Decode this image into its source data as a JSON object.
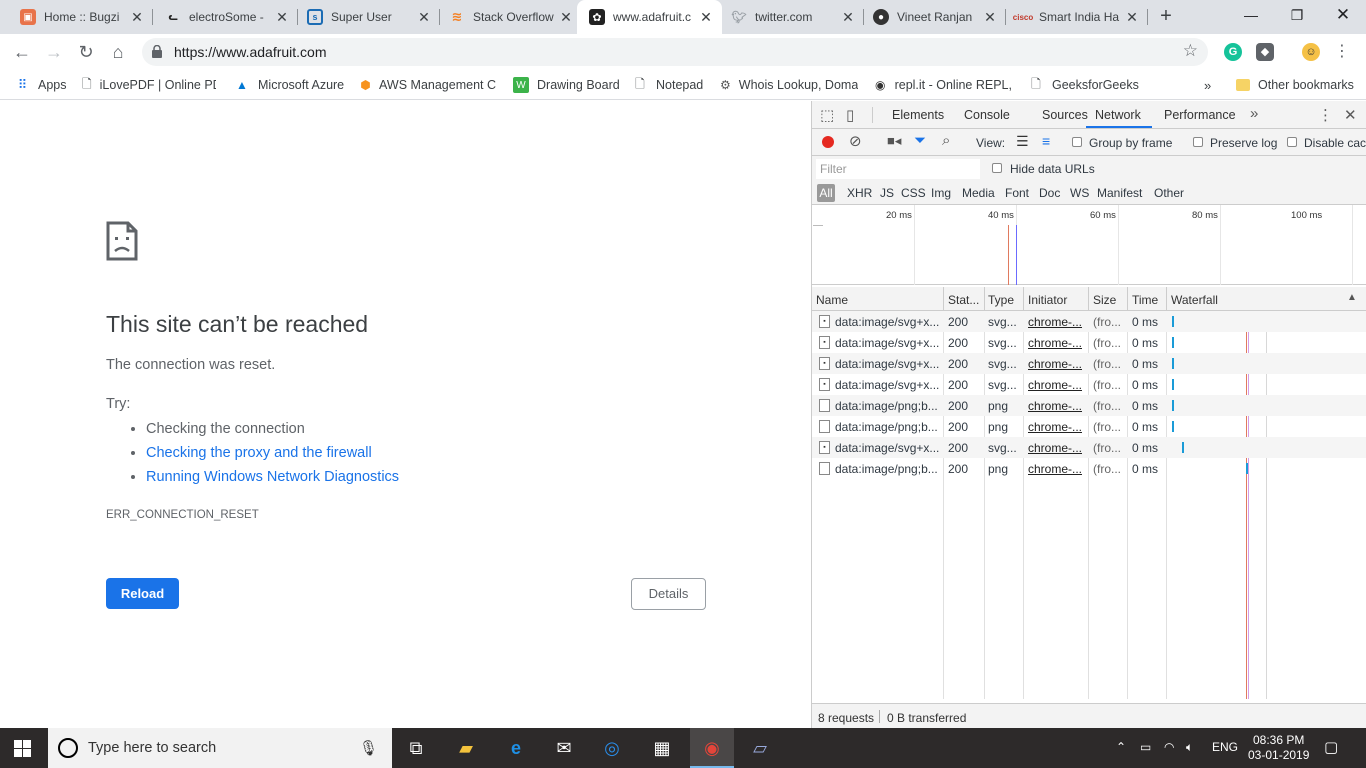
{
  "tabs": [
    {
      "title": "Home :: Bugzi",
      "icon": "bugzilla-icon"
    },
    {
      "title": "electroSome -",
      "icon": "electrosome-icon"
    },
    {
      "title": "Super User",
      "icon": "superuser-icon"
    },
    {
      "title": "Stack Overflow",
      "icon": "stackoverflow-icon"
    },
    {
      "title": "www.adafruit.c",
      "icon": "adafruit-icon",
      "active": true
    },
    {
      "title": "twitter.com",
      "icon": "twitter-icon"
    },
    {
      "title": "Vineet Ranjan",
      "icon": "github-icon"
    },
    {
      "title": "Smart India Ha",
      "icon": "cisco-icon"
    }
  ],
  "address": {
    "url": "https://www.adafruit.com"
  },
  "bookmarks": [
    {
      "label": "Apps",
      "icon": "apps-grid-icon"
    },
    {
      "label": "iLovePDF | Online PD",
      "icon": "page-icon"
    },
    {
      "label": "Microsoft Azure",
      "icon": "azure-icon"
    },
    {
      "label": "AWS Management C",
      "icon": "aws-icon"
    },
    {
      "label": "Drawing Board",
      "icon": "drawing-icon"
    },
    {
      "label": "Notepad",
      "icon": "page-icon"
    },
    {
      "label": "Whois Lookup, Doma",
      "icon": "gear-icon"
    },
    {
      "label": "repl.it - Online REPL,",
      "icon": "replit-icon"
    },
    {
      "label": "GeeksforGeeks",
      "icon": "page-icon"
    }
  ],
  "other_bookmarks": "Other bookmarks",
  "error": {
    "title": "This site can’t be reached",
    "subtitle": "The connection was reset.",
    "try_label": "Try:",
    "suggestions": [
      "Checking the connection",
      "Checking the proxy and the firewall",
      "Running Windows Network Diagnostics"
    ],
    "code": "ERR_CONNECTION_RESET",
    "reload": "Reload",
    "details": "Details"
  },
  "devtools": {
    "tabs": [
      "Elements",
      "Console",
      "Sources",
      "Network",
      "Performance"
    ],
    "active_tab": "Network",
    "view_label": "View:",
    "group_by_frame": "Group by frame",
    "preserve_log": "Preserve log",
    "disable_cache": "Disable cac",
    "filter_placeholder": "Filter",
    "hide_data_urls": "Hide data URLs",
    "types": [
      "All",
      "XHR",
      "JS",
      "CSS",
      "Img",
      "Media",
      "Font",
      "Doc",
      "WS",
      "Manifest",
      "Other"
    ],
    "timeline_labels": [
      "20 ms",
      "40 ms",
      "60 ms",
      "80 ms",
      "100 ms"
    ],
    "columns": [
      "Name",
      "Stat...",
      "Type",
      "Initiator",
      "Size",
      "Time",
      "Waterfall"
    ],
    "rows": [
      {
        "name": "data:image/svg+x...",
        "status": "200",
        "type": "svg...",
        "initiator": "chrome-...",
        "size": "(fro...",
        "time": "0 ms",
        "wf": 0.012
      },
      {
        "name": "data:image/svg+x...",
        "status": "200",
        "type": "svg...",
        "initiator": "chrome-...",
        "size": "(fro...",
        "time": "0 ms",
        "wf": 0.012
      },
      {
        "name": "data:image/svg+x...",
        "status": "200",
        "type": "svg...",
        "initiator": "chrome-...",
        "size": "(fro...",
        "time": "0 ms",
        "wf": 0.012
      },
      {
        "name": "data:image/svg+x...",
        "status": "200",
        "type": "svg...",
        "initiator": "chrome-...",
        "size": "(fro...",
        "time": "0 ms",
        "wf": 0.012
      },
      {
        "name": "data:image/png;b...",
        "status": "200",
        "type": "png",
        "initiator": "chrome-...",
        "size": "(fro...",
        "time": "0 ms",
        "wf": 0.012
      },
      {
        "name": "data:image/png;b...",
        "status": "200",
        "type": "png",
        "initiator": "chrome-...",
        "size": "(fro...",
        "time": "0 ms",
        "wf": 0.012
      },
      {
        "name": "data:image/svg+x...",
        "status": "200",
        "type": "svg...",
        "initiator": "chrome-...",
        "size": "(fro...",
        "time": "0 ms",
        "wf": 0.06
      },
      {
        "name": "data:image/png;b...",
        "status": "200",
        "type": "png",
        "initiator": "chrome-...",
        "size": "(fro...",
        "time": "0 ms",
        "wf": 0.38
      }
    ],
    "summary_requests": "8 requests",
    "summary_transferred": "0 B transferred"
  },
  "taskbar": {
    "search_placeholder": "Type here to search",
    "language": "ENG",
    "time": "08:36 PM",
    "date": "03-01-2019"
  }
}
